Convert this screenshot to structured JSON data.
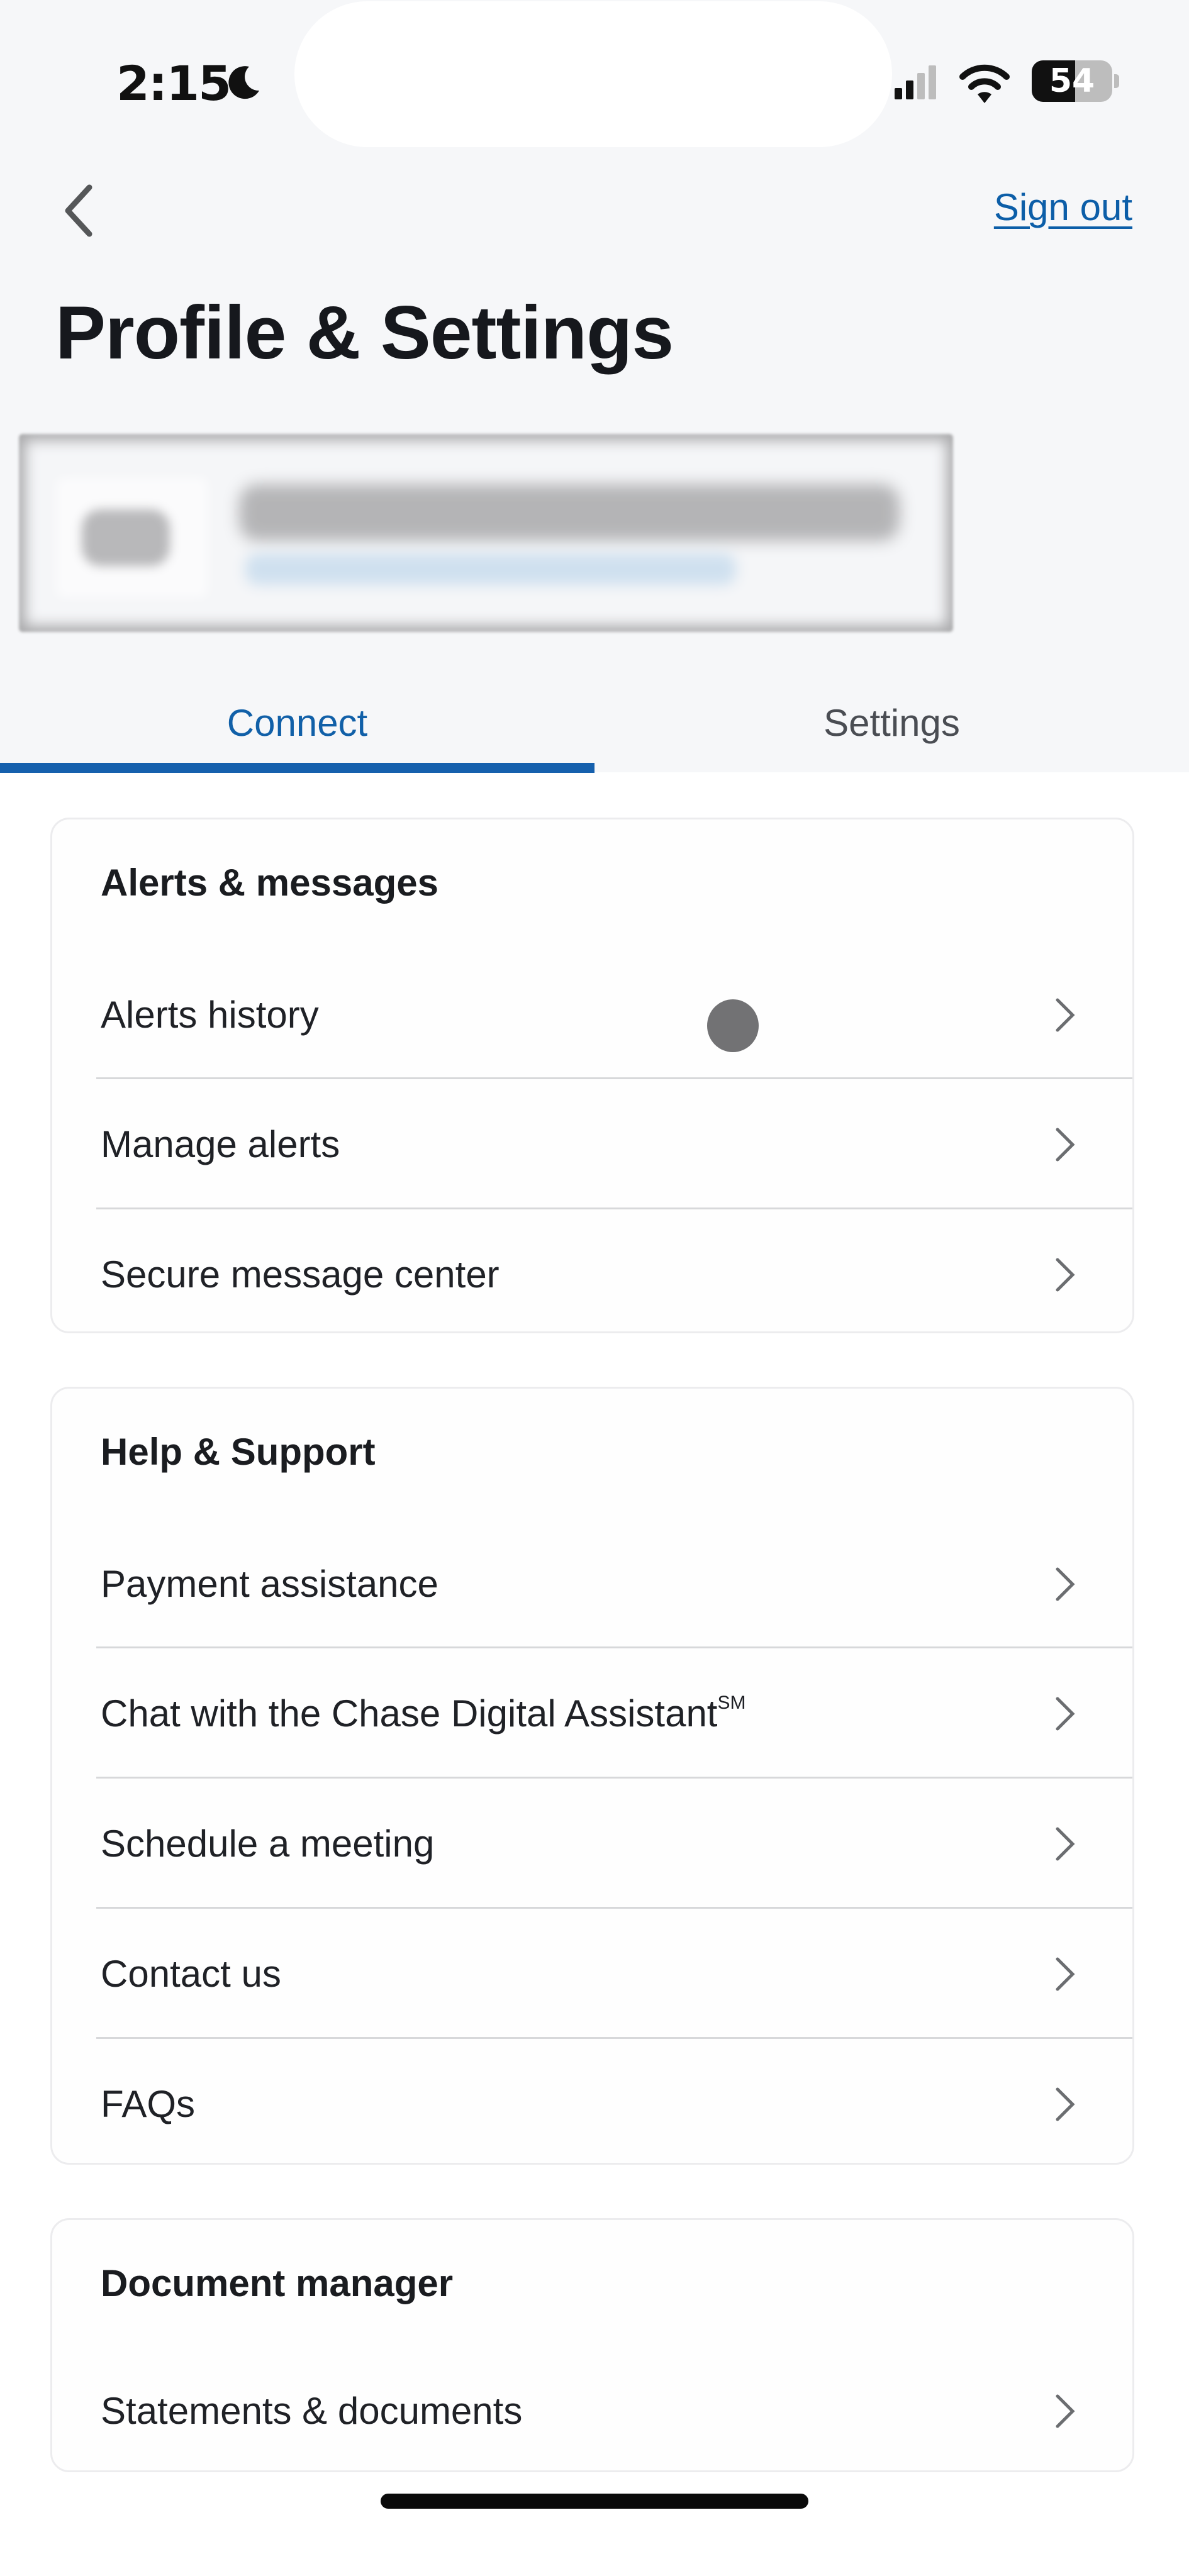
{
  "status_bar": {
    "time": "2:15",
    "focus_icon": "moon-icon",
    "signal_icon": "cellular-signal-icon",
    "wifi_icon": "wifi-icon",
    "battery_level": "54",
    "battery_percent": 54
  },
  "header": {
    "back_icon": "chevron-left-icon",
    "sign_out_label": "Sign out",
    "title": "Profile & Settings"
  },
  "profile": {
    "redacted": true
  },
  "tabs": [
    {
      "label": "Connect",
      "active": true
    },
    {
      "label": "Settings",
      "active": false
    }
  ],
  "sections": [
    {
      "title": "Alerts & messages",
      "items": [
        {
          "label": "Alerts history"
        },
        {
          "label": "Manage alerts"
        },
        {
          "label": "Secure message center"
        }
      ]
    },
    {
      "title": "Help & Support",
      "items": [
        {
          "label": "Payment assistance"
        },
        {
          "label": "Chat with the Chase Digital Assistant",
          "superscript": "SM"
        },
        {
          "label": "Schedule a meeting"
        },
        {
          "label": "Contact us"
        },
        {
          "label": "FAQs"
        }
      ]
    },
    {
      "title": "Document manager",
      "items": [
        {
          "label": "Statements & documents"
        }
      ]
    }
  ],
  "colors": {
    "accent": "#1560ad",
    "link": "#0c5ea8",
    "header_bg": "#f6f7f9",
    "text": "#1a1c20"
  }
}
